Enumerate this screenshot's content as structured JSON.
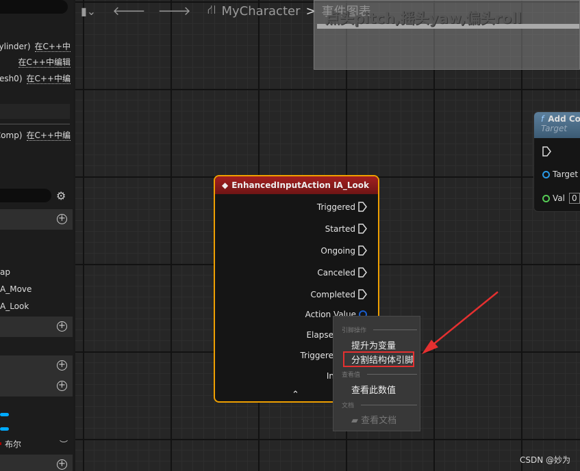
{
  "left_panel": {
    "rows": [
      {
        "text": "Cylinder)",
        "link": "在C++中"
      },
      {
        "text": "",
        "link": "在C++中编辑"
      },
      {
        "text": "esh0)",
        "link": "在C++中编"
      },
      {
        "text": "Comp)",
        "link": "在C++中编"
      }
    ],
    "items": [
      "ap",
      "A_Move",
      "A_Look"
    ],
    "bool_label": "布尔"
  },
  "toolbar": {
    "breadcrumb_root": "MyCharacter",
    "separator": ">",
    "breadcrumb_current": "事件图表"
  },
  "comment": {
    "title": "点头pitch,摇头yaw,偏头roll"
  },
  "node": {
    "title": "EnhancedInputAction IA_Look",
    "exec_pins": [
      "Triggered",
      "Started",
      "Ongoing",
      "Canceled",
      "Completed"
    ],
    "data_pins": [
      "Action Value",
      "Elapsed Sec",
      "Triggered Sec",
      "Input A"
    ],
    "header_color": "#a42020",
    "selected_border": "#f0a000"
  },
  "context_menu": {
    "sections": [
      {
        "header": "引脚操作",
        "items": [
          "提升为变量",
          "分割结构体引脚"
        ]
      },
      {
        "header": "查看值",
        "items": [
          "查看此数值"
        ]
      },
      {
        "header": "文档",
        "items": [
          "查看文档"
        ]
      }
    ],
    "highlighted": "分割结构体引脚"
  },
  "function_node": {
    "title": "Add Co",
    "subtitle": "Target",
    "pins": [
      "Target",
      "Val"
    ],
    "val_value": "0"
  },
  "watermark": "CSDN @妙为"
}
